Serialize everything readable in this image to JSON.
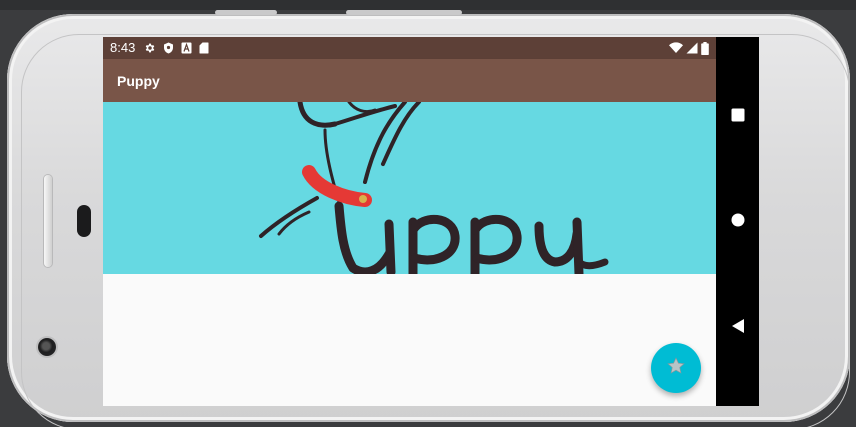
{
  "status_bar": {
    "time": "8:43",
    "left_icons": [
      "gear-icon",
      "shield-icon",
      "font-a-icon",
      "sd-card-icon"
    ],
    "right_icons": [
      "wifi-icon",
      "cell-signal-icon",
      "battery-icon"
    ]
  },
  "app_bar": {
    "title": "Puppy"
  },
  "hero": {
    "image": "puppy-logo-illustration",
    "background_color": "#66d9e2"
  },
  "fab": {
    "icon": "star-icon",
    "color": "#00bcd4"
  },
  "nav_bar": {
    "buttons": [
      "recents-square-icon",
      "home-circle-icon",
      "back-triangle-icon"
    ]
  },
  "colors": {
    "status_bar": "#5d4037",
    "app_bar": "#795548",
    "content_background": "#fafafa"
  }
}
